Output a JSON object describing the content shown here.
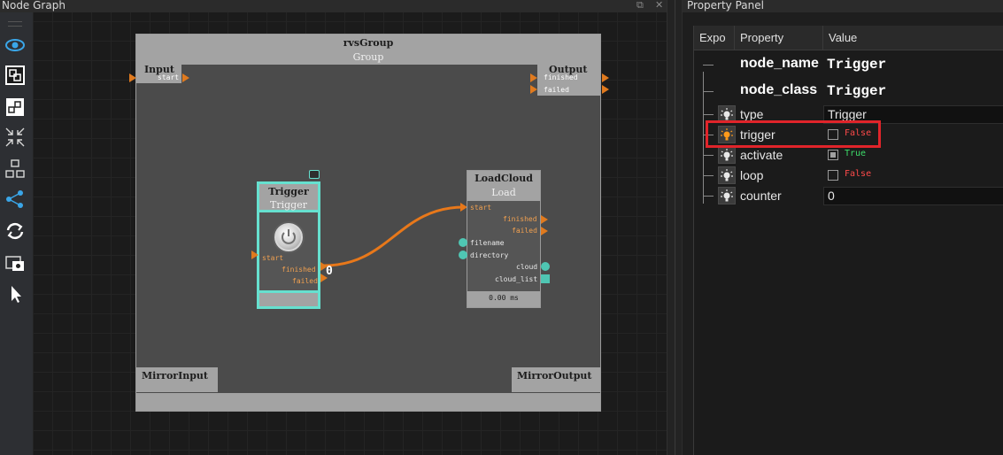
{
  "node_graph": {
    "title": "Node Graph",
    "window_buttons": [
      "⧉",
      "✕"
    ],
    "toolbar": [
      {
        "icon": "eye-icon",
        "name": "toggle-visibility"
      },
      {
        "icon": "group-nodes-icon",
        "name": "group-nodes"
      },
      {
        "icon": "ungroup-nodes-icon",
        "name": "ungroup-nodes"
      },
      {
        "icon": "collapse-arrows-icon",
        "name": "fit-view"
      },
      {
        "icon": "layout-tree-icon",
        "name": "auto-layout"
      },
      {
        "icon": "connect-nodes-icon",
        "name": "connect-nodes"
      },
      {
        "icon": "refresh-icon",
        "name": "refresh"
      },
      {
        "icon": "screenshot-icon",
        "name": "screenshot"
      },
      {
        "icon": "cursor-icon",
        "name": "select-cursor"
      }
    ],
    "group": {
      "title": "rvsGroup",
      "subtitle": "Group",
      "input": {
        "title": "Input",
        "port": "start"
      },
      "output": {
        "title": "Output",
        "ports": [
          "finished",
          "failed"
        ]
      },
      "mirror_input": "MirrorInput",
      "mirror_output": "MirrorOutput"
    },
    "trigger_node": {
      "title": "Trigger",
      "subtitle": "Trigger",
      "ports": {
        "in": "start",
        "out": [
          "finished",
          "failed"
        ]
      }
    },
    "loadcloud_node": {
      "title": "LoadCloud",
      "subtitle": "Load",
      "in_ports": [
        "start",
        "filename",
        "directory"
      ],
      "out_ports": [
        "finished",
        "failed",
        "cloud",
        "cloud_list"
      ],
      "time": "0.00 ms"
    },
    "edge_value": "0"
  },
  "property_panel": {
    "title": "Property Panel",
    "columns": [
      "Expo",
      "Property",
      "Value"
    ],
    "rows": [
      {
        "property": "node_name",
        "value": "Trigger",
        "kind": "header"
      },
      {
        "property": "node_class",
        "value": "Trigger",
        "kind": "header"
      },
      {
        "property": "type",
        "value": "Trigger",
        "kind": "text"
      },
      {
        "property": "trigger",
        "value": "False",
        "kind": "bool",
        "checked": false
      },
      {
        "property": "activate",
        "value": "True",
        "kind": "bool",
        "checked": true
      },
      {
        "property": "loop",
        "value": "False",
        "kind": "bool",
        "checked": false
      },
      {
        "property": "counter",
        "value": "0",
        "kind": "text"
      }
    ]
  },
  "colors": {
    "accent_teal": "#66e0cf",
    "port_orange": "#e07a1e",
    "true_green": "#3ddc6a",
    "false_red": "#ff4a4a",
    "highlight_red": "#e0242a",
    "bulb_orange": "#ff9a1a"
  }
}
